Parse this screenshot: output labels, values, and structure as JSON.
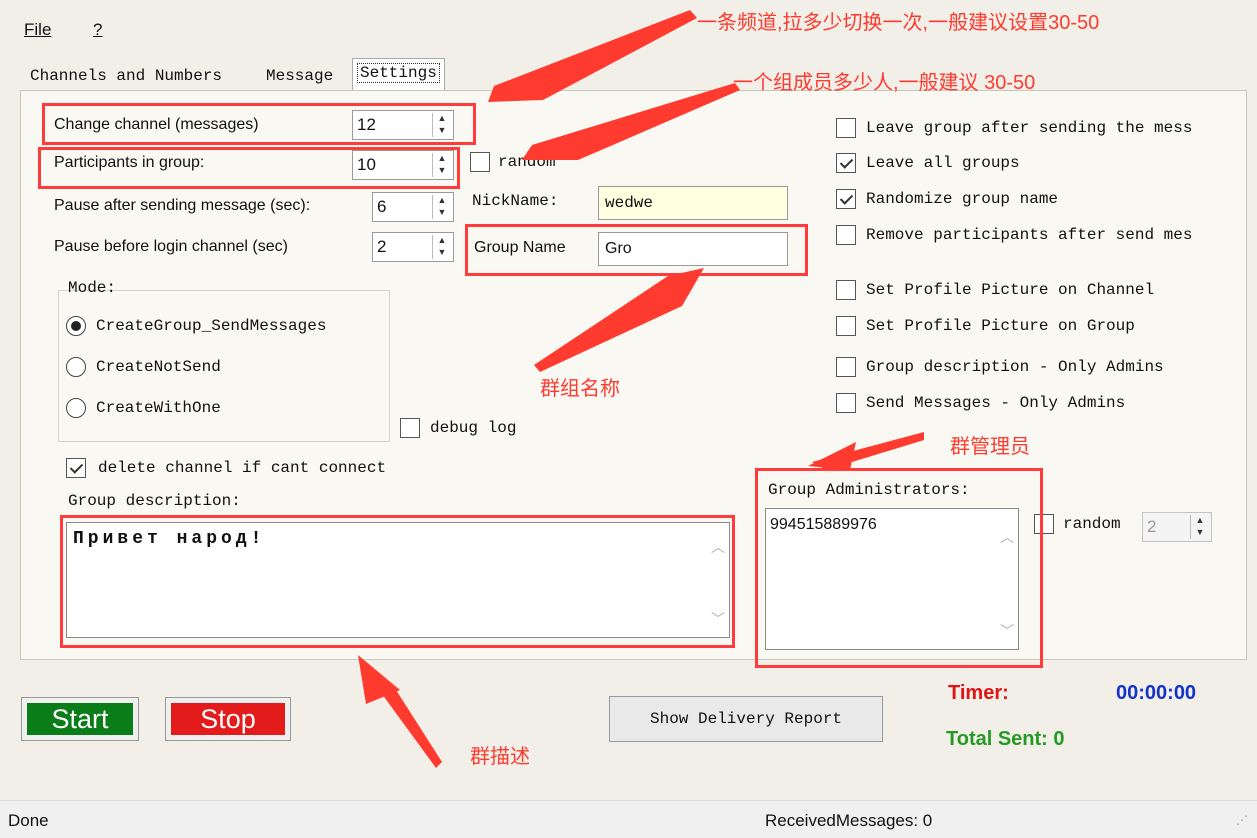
{
  "menu": {
    "file": "File",
    "help": "?"
  },
  "tabs": [
    {
      "label": "Channels and Numbers"
    },
    {
      "label": "Message"
    },
    {
      "label": "Settings"
    }
  ],
  "fields": {
    "change_channel": {
      "label": "Change channel (messages)",
      "value": "12"
    },
    "participants": {
      "label": "Participants in group:",
      "value": "10",
      "random_label": "random"
    },
    "pause_after": {
      "label": "Pause after sending message (sec):",
      "value": "6"
    },
    "pause_before": {
      "label": "Pause before login channel (sec)",
      "value": "2"
    },
    "nickname": {
      "label": "NickName:",
      "value": "wedwe"
    },
    "group_name": {
      "label": "Group Name",
      "value": "Gro"
    }
  },
  "mode": {
    "label": "Mode:",
    "options": [
      "CreateGroup_SendMessages",
      "CreateNotSend",
      "CreateWithOne"
    ],
    "selected": "CreateGroup_SendMessages"
  },
  "debug_log": {
    "label": "debug log",
    "checked": false
  },
  "delete_channel": {
    "label": "delete channel if cant connect",
    "checked": true
  },
  "group_description": {
    "label": "Group description:",
    "value": "Привет народ!"
  },
  "options": [
    {
      "label": "Leave group after sending the mess",
      "checked": false
    },
    {
      "label": "Leave all groups",
      "checked": true
    },
    {
      "label": "Randomize group name",
      "checked": true
    },
    {
      "label": "Remove participants after send mes",
      "checked": false
    },
    {
      "label": "Set Profile Picture on Channel",
      "checked": false
    },
    {
      "label": "Set Profile Picture on Group",
      "checked": false
    },
    {
      "label": "Group description - Only Admins",
      "checked": false
    },
    {
      "label": "Send Messages - Only Admins",
      "checked": false
    }
  ],
  "admins": {
    "label": "Group Administrators:",
    "value": "994515889976",
    "random_label": "random",
    "random_count": "2"
  },
  "buttons": {
    "start": "Start",
    "stop": "Stop",
    "report": "Show Delivery Report"
  },
  "timer": {
    "label": "Timer:",
    "value": "00:00:00"
  },
  "total_sent": "Total Sent: 0",
  "status": {
    "left": "Done",
    "received": "ReceivedMessages: 0"
  },
  "annotations": {
    "channel_switch": "一条频道,拉多少切换一次,一般建议设置30-50",
    "group_members": "一个组成员多少人,一般建议 30-50",
    "group_name": "群组名称",
    "group_admin": "群管理员",
    "group_desc": "群描述"
  },
  "colors": {
    "annotation": "#ff3b30",
    "start": "#0a7d18",
    "stop": "#e31b1b",
    "timer_label": "#e01414",
    "timer_value": "#1533c8",
    "total_sent": "#249a24"
  }
}
